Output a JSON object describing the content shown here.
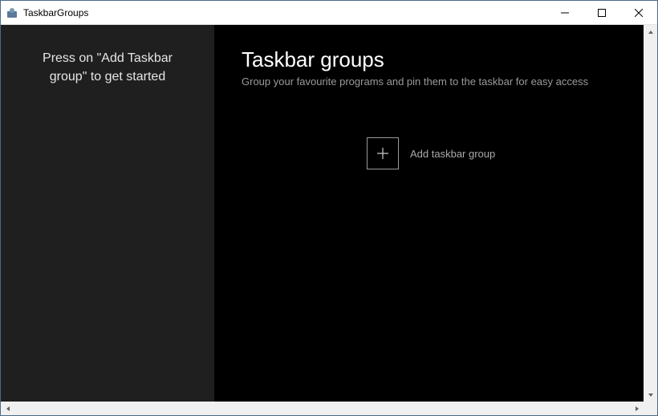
{
  "window": {
    "title": "TaskbarGroups"
  },
  "sidebar": {
    "hint_line1": "Press on \"Add Taskbar",
    "hint_line2": "group\" to get started"
  },
  "main": {
    "title": "Taskbar groups",
    "subtitle": "Group your favourite programs and pin them to the taskbar for easy access",
    "add_label": "Add taskbar group"
  }
}
